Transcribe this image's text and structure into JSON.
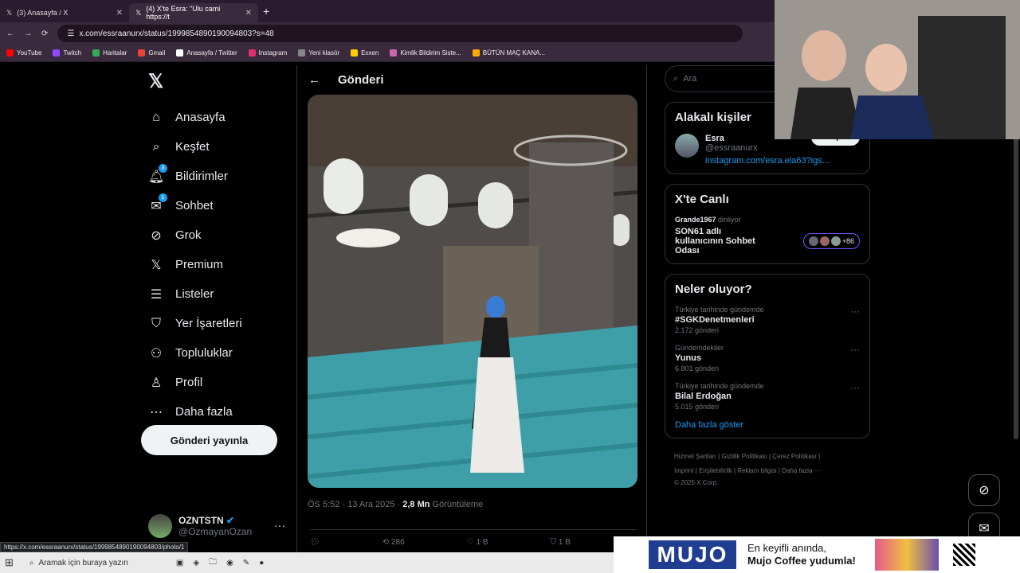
{
  "browser": {
    "tabs": [
      {
        "title": "(3) Anasayfa / X"
      },
      {
        "title": "(4) X'te Esra: \"Ulu cami https://t"
      }
    ],
    "url": "x.com/essraanurx/status/1999854890190094803?s=48",
    "bookmarks": [
      "YouTube",
      "Twitch",
      "Haritalar",
      "Gmail",
      "Anasayfa / Twitter",
      "Instagram",
      "Yeni klasör",
      "Exxen",
      "Kimlik Bildirim Siste...",
      "BÜTÜN MAÇ KANA..."
    ],
    "status_url": "https://x.com/essraanurx/status/1999854890190094803/photo/1"
  },
  "nav": {
    "items": [
      {
        "label": "Anasayfa",
        "icon": "home-icon"
      },
      {
        "label": "Keşfet",
        "icon": "search-icon"
      },
      {
        "label": "Bildirimler",
        "icon": "bell-icon",
        "badge": "3"
      },
      {
        "label": "Sohbet",
        "icon": "mail-icon",
        "badge": "1"
      },
      {
        "label": "Grok",
        "icon": "grok-icon"
      },
      {
        "label": "Premium",
        "icon": "x-icon"
      },
      {
        "label": "Listeler",
        "icon": "list-icon"
      },
      {
        "label": "Yer İşaretleri",
        "icon": "bookmark-icon"
      },
      {
        "label": "Topluluklar",
        "icon": "people-icon"
      },
      {
        "label": "Profil",
        "icon": "person-icon"
      },
      {
        "label": "Daha fazla",
        "icon": "more-icon"
      }
    ],
    "post_button": "Gönderi yayınla",
    "account_name": "OZNTSTN",
    "account_handle": "@OzmayanOzan"
  },
  "post": {
    "header": "Gönderi",
    "time": "ÖS 5:52 · 13 Ara 2025 ·",
    "views": "2,8 Mn",
    "views_label": "Görüntüleme",
    "retweets": "286",
    "likes": "1 B",
    "bookmarks": "1 B"
  },
  "sidebar": {
    "search_placeholder": "Ara",
    "related_title": "Alakalı kişiler",
    "person_name": "Esra",
    "person_handle": "@essraanurx",
    "person_link": "instagram.com/esra.ela63?igs...",
    "follow_label": "Takip et",
    "live_title": "X'te Canlı",
    "live_host": "Grande1967",
    "live_status": "dinliyor",
    "live_room": "SON61 adlı kullanıcının Sohbet Odası",
    "live_count": "+86",
    "trends_title": "Neler oluyor?",
    "trends": [
      {
        "context": "Türkiye tarihinde gündemde",
        "name": "#SGKDenetmenleri",
        "count": "2.172 gönderi"
      },
      {
        "context": "Gündemdekiler",
        "name": "Yunus",
        "count": "6.801 gönderi"
      },
      {
        "context": "Türkiye tarihinde gündemde",
        "name": "Bilal Erdoğan",
        "count": "5.015 gönderi"
      }
    ],
    "show_more": "Daha fazla göster",
    "footer1": "Hizmet Şartları  |  Gizlilik Politikası  |  Çerez Politikası  |",
    "footer2": "Imprint  |  Erişilebilirlik  |  Reklam bilgisi  |  Daha fazla ···",
    "footer3": "© 2025 X Corp."
  },
  "ad": {
    "brand": "MUJO",
    "line1": "En keyifli anında,",
    "line2": "Mujo Coffee yudumla!"
  },
  "taskbar": {
    "search_placeholder": "Aramak için buraya yazın"
  }
}
